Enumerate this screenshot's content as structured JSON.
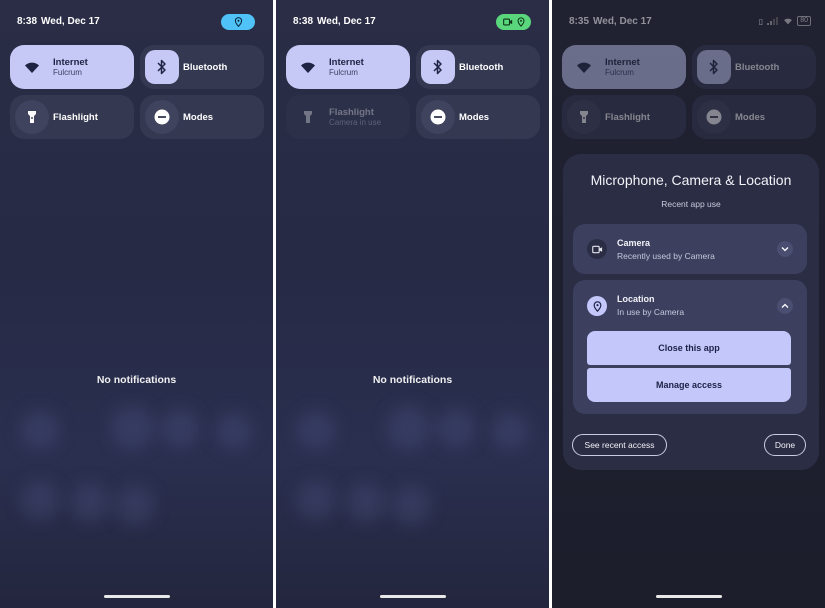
{
  "panels": [
    {
      "time": "8:38",
      "date": "Wed, Dec 17",
      "tiles": {
        "internet": {
          "label": "Internet",
          "sub": "Fulcrum"
        },
        "bluetooth": {
          "label": "Bluetooth"
        },
        "flashlight": {
          "label": "Flashlight"
        },
        "modes": {
          "label": "Modes"
        }
      },
      "notifications_text": "No notifications",
      "chip_color": "#4fc3f7"
    },
    {
      "time": "8:38",
      "date": "Wed, Dec 17",
      "tiles": {
        "internet": {
          "label": "Internet",
          "sub": "Fulcrum"
        },
        "bluetooth": {
          "label": "Bluetooth"
        },
        "flashlight": {
          "label": "Flashlight",
          "sub": "Camera in use"
        },
        "modes": {
          "label": "Modes"
        }
      },
      "notifications_text": "No notifications",
      "chip_color": "#5ad67d"
    },
    {
      "time": "8:35",
      "date": "Wed, Dec 17",
      "battery": "80",
      "tiles": {
        "internet": {
          "label": "Internet",
          "sub": "Fulcrum"
        },
        "bluetooth": {
          "label": "Bluetooth"
        },
        "flashlight": {
          "label": "Flashlight"
        },
        "modes": {
          "label": "Modes"
        }
      },
      "dialog": {
        "title": "Microphone, Camera & Location",
        "subtitle": "Recent app use",
        "camera": {
          "title": "Camera",
          "desc": "Recently used by Camera"
        },
        "location": {
          "title": "Location",
          "desc": "In use by Camera"
        },
        "close_app": "Close this app",
        "manage_access": "Manage access",
        "see_recent": "See recent access",
        "done": "Done"
      }
    }
  ],
  "colors": {
    "tile_on": "#c6c9f5",
    "tile_off": "#343851",
    "accent_button": "#c3c7fa"
  }
}
